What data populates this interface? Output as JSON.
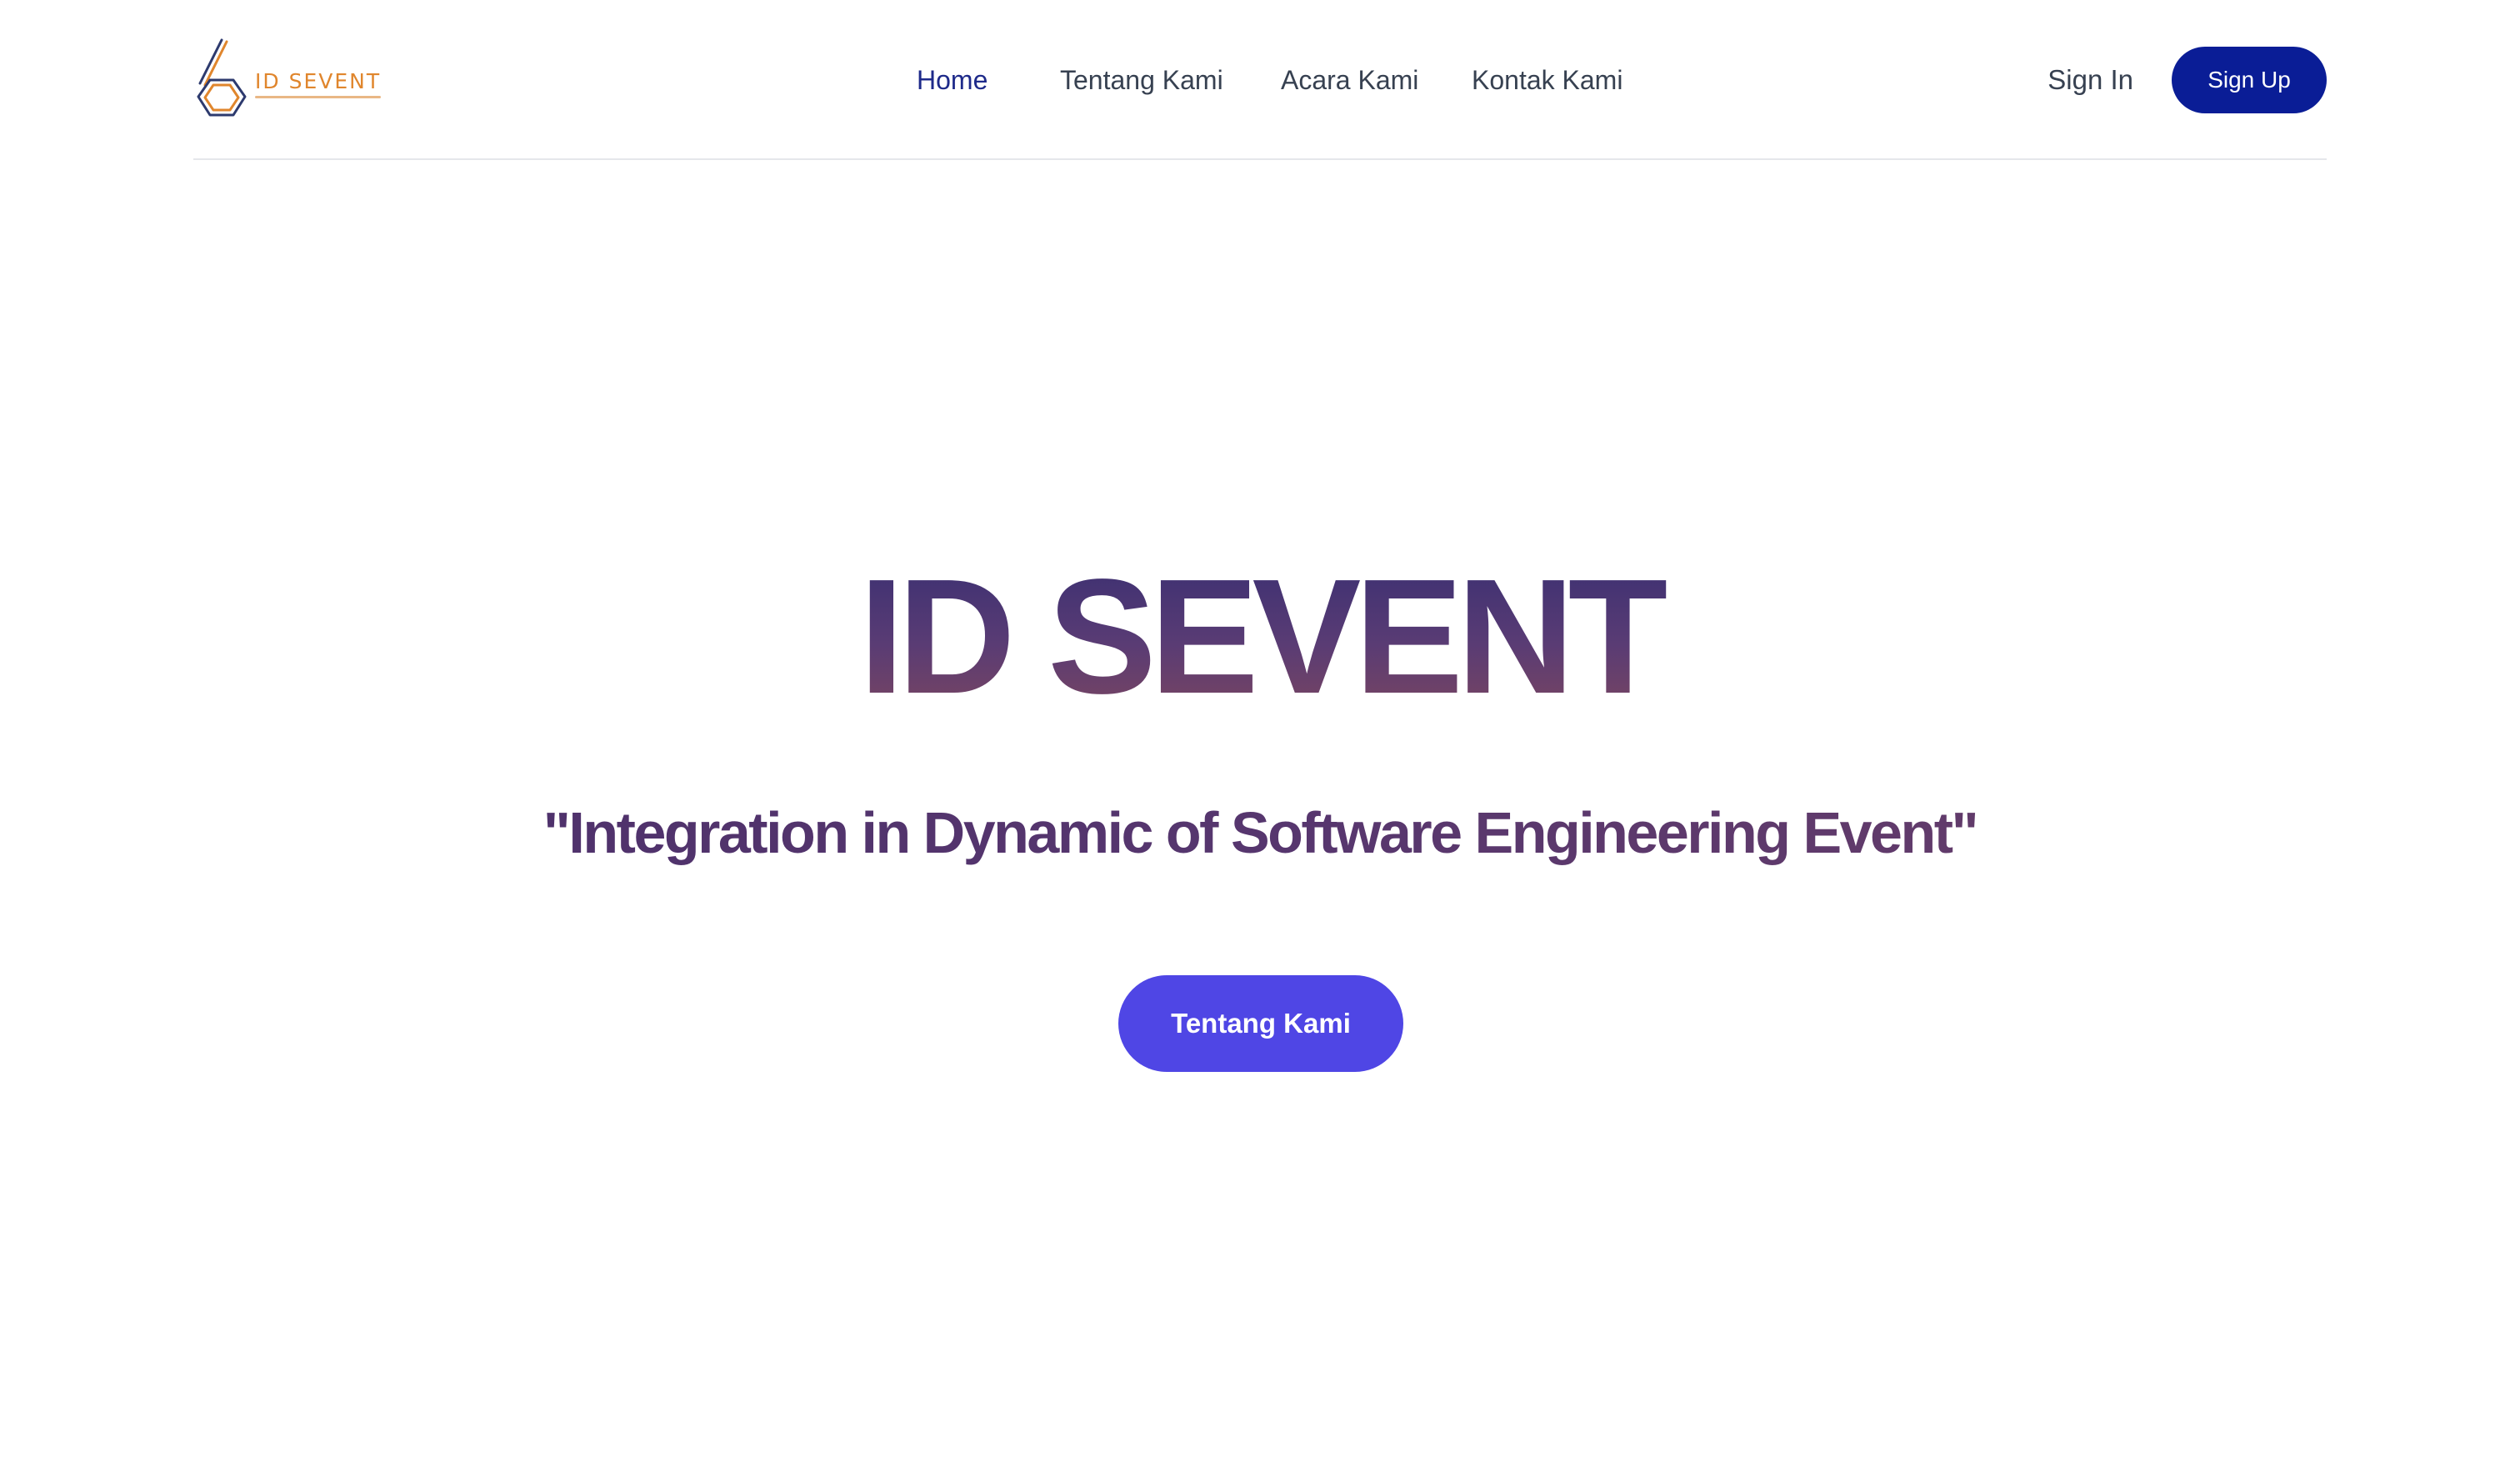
{
  "header": {
    "logo": {
      "word": "ID SEVENT"
    },
    "nav": [
      {
        "label": "Home",
        "active": true
      },
      {
        "label": "Tentang Kami",
        "active": false
      },
      {
        "label": "Acara Kami",
        "active": false
      },
      {
        "label": "Kontak Kami",
        "active": false
      }
    ],
    "sign_in_label": "Sign In",
    "sign_up_label": "Sign Up"
  },
  "hero": {
    "title": "ID SEVENT",
    "subtitle": "\"Integration in Dynamic of Software Engineering Event\"",
    "cta_label": "Tentang Kami"
  },
  "colors": {
    "primary_dark": "#0a1d96",
    "active_link": "#1e2a8a",
    "cta": "#4f46e5",
    "logo_orange": "#e0862d",
    "title_gradient_start": "#3a2f72",
    "title_gradient_end": "#7a4560"
  }
}
